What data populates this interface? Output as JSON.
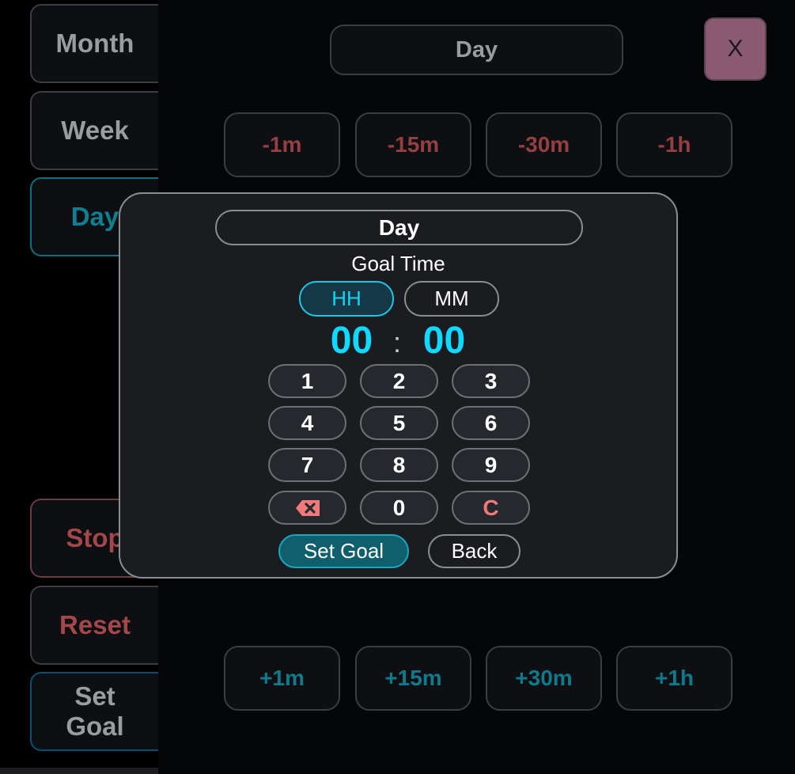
{
  "sidebar": {
    "items": [
      {
        "label": "Month"
      },
      {
        "label": "Week"
      },
      {
        "label": "Day"
      },
      {
        "label": "Stop"
      },
      {
        "label": "Reset"
      },
      {
        "label": "Set Goal"
      }
    ]
  },
  "header": {
    "view_label": "Day",
    "close_label": "X"
  },
  "adjust": {
    "minus": [
      "-1m",
      "-15m",
      "-30m",
      "-1h"
    ],
    "plus": [
      "+1m",
      "+15m",
      "+30m",
      "+1h"
    ]
  },
  "modal": {
    "title": "Day",
    "subtitle": "Goal Time",
    "units": {
      "hours": "HH",
      "minutes": "MM"
    },
    "time": {
      "hours": "00",
      "separator": ":",
      "minutes": "00"
    },
    "keys": [
      "1",
      "2",
      "3",
      "4",
      "5",
      "6",
      "7",
      "8",
      "9",
      "0"
    ],
    "clear_label": "C",
    "backspace_icon": "backspace-icon",
    "set_goal_label": "Set Goal",
    "back_label": "Back"
  },
  "colors": {
    "accent": "#10d8ff",
    "danger": "#a4474a",
    "close": "#8a5a72"
  }
}
